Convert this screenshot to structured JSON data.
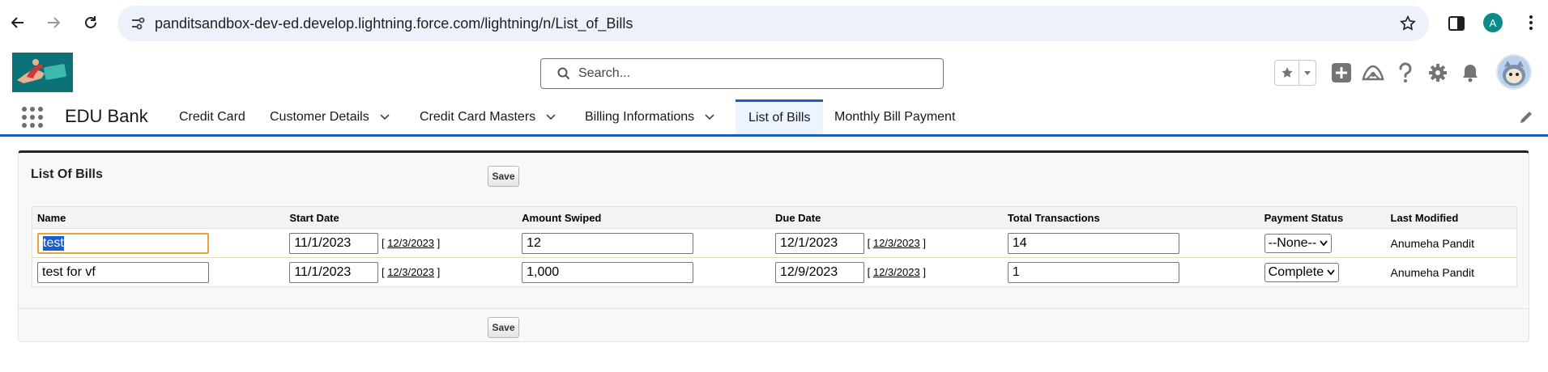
{
  "browser": {
    "url": "panditsandbox-dev-ed.develop.lightning.force.com/lightning/n/List_of_Bills",
    "profile_initial": "A"
  },
  "header": {
    "search_placeholder": "Search..."
  },
  "app": {
    "name": "EDU Bank",
    "nav_items": [
      {
        "label": "Credit Card",
        "has_menu": false
      },
      {
        "label": "Customer Details",
        "has_menu": true
      },
      {
        "label": "Credit Card Masters",
        "has_menu": true
      },
      {
        "label": "Billing Informations",
        "has_menu": true
      },
      {
        "label": "List of Bills",
        "has_menu": false,
        "active": true
      },
      {
        "label": "Monthly Bill Payment",
        "has_menu": false
      }
    ]
  },
  "page_block": {
    "title": "List Of Bills",
    "save_label": "Save",
    "columns": [
      "Name",
      "Start Date",
      "Amount Swiped",
      "Due Date",
      "Total Transactions",
      "Payment Status",
      "Last Modified"
    ],
    "rows": [
      {
        "name": "test",
        "start_date": "11/1/2023",
        "start_today": "12/3/2023",
        "amount": "12",
        "due_date": "12/1/2023",
        "due_today": "12/3/2023",
        "transactions": "14",
        "status": "--None--",
        "last_modified": "Anumeha Pandit"
      },
      {
        "name": "test for vf",
        "start_date": "11/1/2023",
        "start_today": "12/3/2023",
        "amount": "1,000",
        "due_date": "12/9/2023",
        "due_today": "12/3/2023",
        "transactions": "1",
        "status": "Complete",
        "last_modified": "Anumeha Pandit"
      }
    ],
    "bracket_open": "[",
    "bracket_close": "]"
  },
  "colors": {
    "brand_blue": "#1b5dbd",
    "logo_teal": "#0d7278",
    "omnibox_bg": "#edf2fa"
  }
}
